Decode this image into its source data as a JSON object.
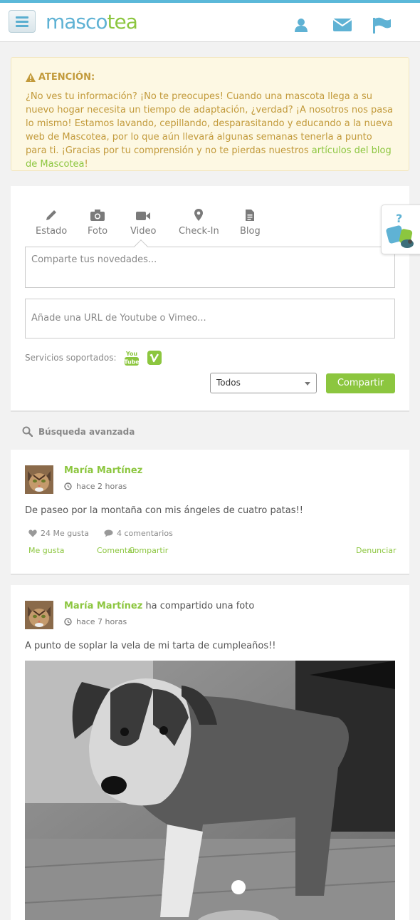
{
  "brand": {
    "logo_part1": "masco",
    "logo_part2": "tea",
    "primary": "#5fb2d4",
    "accent": "#8cc63f"
  },
  "topbar": {
    "icons": [
      "menu-icon",
      "user-icon",
      "envelope-icon",
      "flag-icon"
    ]
  },
  "alert": {
    "title": "ATENCIÓN:",
    "text": "¿No ves tu información? ¡No te preocupes! Cuando una mascota llega a su nuevo hogar necesita un tiempo de adaptación, ¿verdad? ¡A nosotros nos pasa lo mismo! Estamos lavando, cepillando, desparasitando y educando a la nueva web de Mascotea, por lo que aún llevará algunas semanas tenerla a punto para ti. ¡Gracias por tu comprensión y no te pierdas nuestros ",
    "link": "artículos del blog de Mascotea",
    "text_end": "!"
  },
  "composer": {
    "tabs": [
      {
        "label": "Estado",
        "icon": "pencil-icon"
      },
      {
        "label": "Foto",
        "icon": "camera-icon"
      },
      {
        "label": "Video",
        "icon": "video-icon"
      },
      {
        "label": "Check-In",
        "icon": "map-marker-icon"
      },
      {
        "label": "Blog",
        "icon": "document-icon"
      }
    ],
    "placeholder": "Comparte tus novedades...",
    "url_placeholder": "Añade una URL de Youtube o Vimeo...",
    "services_label": "Servicios soportados:",
    "privacy_value": "Todos",
    "share_label": "Compartir"
  },
  "search": {
    "label": "Búsqueda avanzada"
  },
  "posts": [
    {
      "author": "María Martínez",
      "suffix": "",
      "time": "hace 2 horas",
      "text": "De paseo por la montaña con mis ángeles de cuatro patas!!",
      "likes": "24 Me gusta",
      "comments": "4 comentarios",
      "actions": [
        "Me gusta",
        "Comentar",
        "Compartir"
      ],
      "report": "Denunciar"
    },
    {
      "author": "María Martínez",
      "suffix": " ha compartido una foto",
      "time": "hace 7 horas",
      "text": "A punto de soplar la vela de mi tarta de cumpleaños!!"
    }
  ]
}
